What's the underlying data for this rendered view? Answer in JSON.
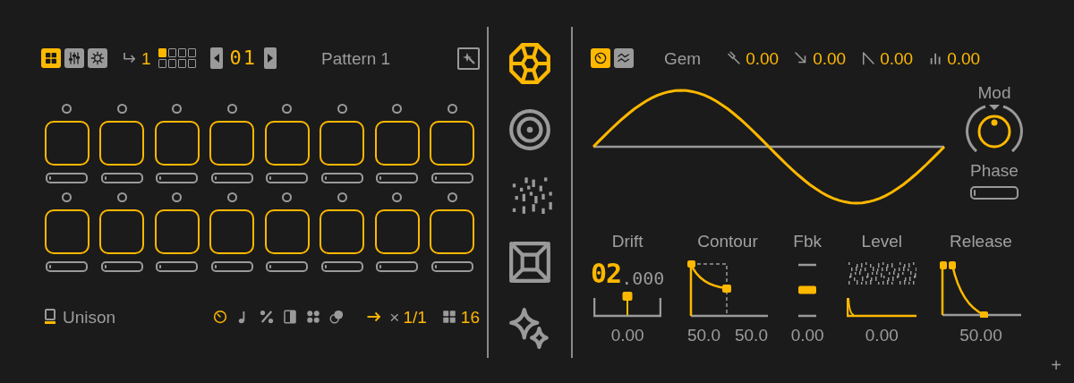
{
  "pattern_bar": {
    "view_buttons": [
      {
        "kind": "grid",
        "selected": true
      },
      {
        "kind": "mixer",
        "selected": false
      },
      {
        "kind": "settings",
        "selected": false
      }
    ],
    "repeat": "1",
    "pages": [
      {
        "selected": true
      },
      {
        "selected": false
      },
      {
        "selected": false
      },
      {
        "selected": false
      },
      {
        "selected": false
      },
      {
        "selected": false
      },
      {
        "selected": false
      },
      {
        "selected": false
      }
    ],
    "pattern_number": "01",
    "pattern_name": "Pattern 1"
  },
  "pads": [
    {
      "level": 0
    },
    {
      "level": 0
    },
    {
      "level": 0
    },
    {
      "level": 0
    },
    {
      "level": 0
    },
    {
      "level": 0
    },
    {
      "level": 0
    },
    {
      "level": 0
    },
    {
      "level": 0
    },
    {
      "level": 0
    },
    {
      "level": 0
    },
    {
      "level": 0
    },
    {
      "level": 0
    },
    {
      "level": 0
    },
    {
      "level": 0
    },
    {
      "level": 0
    }
  ],
  "footer": {
    "voice_mode": "Unison",
    "modes": [
      {
        "kind": "clock",
        "selected": true
      },
      {
        "kind": "note",
        "selected": false
      },
      {
        "kind": "percent",
        "selected": false
      },
      {
        "kind": "half",
        "selected": false
      },
      {
        "kind": "dots",
        "selected": false
      },
      {
        "kind": "toggle",
        "selected": false
      }
    ],
    "multiplier_sign": "×",
    "rate": "1/1",
    "steps": "16"
  },
  "engines": [
    {
      "kind": "gem",
      "selected": true
    },
    {
      "kind": "rings",
      "selected": false
    },
    {
      "kind": "noise",
      "selected": false
    },
    {
      "kind": "box",
      "selected": false
    },
    {
      "kind": "sparkle",
      "selected": false
    }
  ],
  "engine_panel": {
    "wave_buttons": [
      {
        "kind": "clock",
        "selected": true
      },
      {
        "kind": "wave",
        "selected": false
      }
    ],
    "engine_name": "Gem",
    "params": [
      {
        "kind": "tuning",
        "value": "0.00"
      },
      {
        "kind": "arrow",
        "value": "0.00"
      },
      {
        "kind": "slope",
        "value": "0.00"
      },
      {
        "kind": "bars",
        "value": "0.00"
      }
    ],
    "mod_label": "Mod",
    "phase_label": "Phase",
    "phase": {
      "level": 0
    },
    "controls": [
      {
        "kind": "drift",
        "label": "Drift",
        "display_main": "02",
        "display_fraction": ".000",
        "level": 0.5,
        "values": [
          "0.00"
        ]
      },
      {
        "kind": "contour",
        "label": "Contour",
        "values": [
          "50.0",
          "50.0"
        ]
      },
      {
        "kind": "fbk",
        "label": "Fbk",
        "level": 0.5,
        "values": [
          "0.00"
        ]
      },
      {
        "kind": "level",
        "label": "Level",
        "values": [
          "0.00"
        ]
      },
      {
        "kind": "release",
        "label": "Release",
        "values": [
          "50.00"
        ]
      }
    ]
  },
  "add_symbol": "+"
}
